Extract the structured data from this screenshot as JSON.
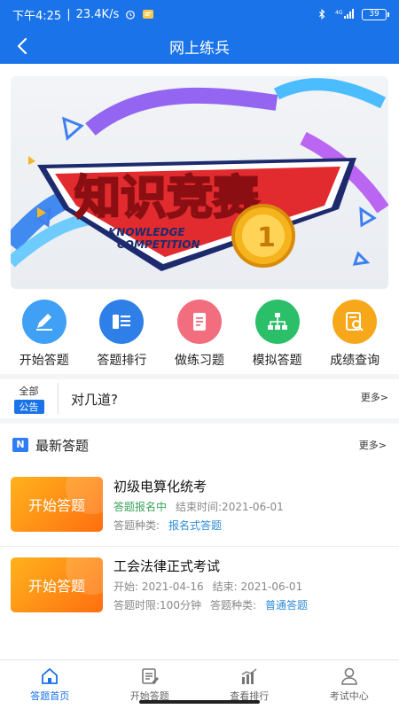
{
  "status": {
    "time": "下午4:25",
    "speed": "23.4K/s",
    "battery": "39",
    "signal_label": "4G"
  },
  "nav": {
    "title": "网上练兵",
    "back_icon": "back-arrow-icon"
  },
  "banner": {
    "title": "知识竞赛",
    "subtitle_line1": "KNOWLEDGE",
    "subtitle_line2": "COMPETITION",
    "medal_number": "1"
  },
  "grid": [
    {
      "label": "开始答题",
      "icon": "pencil-icon",
      "color": "#3fa0f5"
    },
    {
      "label": "答题排行",
      "icon": "ranking-list-icon",
      "color": "#2f7fe8"
    },
    {
      "label": "做练习题",
      "icon": "document-icon",
      "color": "#f26d7d"
    },
    {
      "label": "模拟答题",
      "icon": "org-chart-icon",
      "color": "#2bbf6a"
    },
    {
      "label": "成绩查询",
      "icon": "search-document-icon",
      "color": "#f7a81a"
    }
  ],
  "notice": {
    "all": "全部",
    "badge": "公告",
    "text": "对几道?",
    "more": "更多>"
  },
  "section": {
    "icon_text": "N",
    "title": "最新答题",
    "more": "更多>"
  },
  "exams": [
    {
      "thumb": "开始答题",
      "title": "初级电算化统考",
      "line1_a": "答题报名中",
      "line1_b": "结束时间:2021-06-01",
      "line2_label": "答题种类:",
      "line2_value": "报名式答题"
    },
    {
      "thumb": "开始答题",
      "title": "工会法律正式考试",
      "line1_a": "开始:  2021-04-16",
      "line1_b": "结束:  2021-06-01",
      "line2_label": "答题时限:100分钟",
      "line2_label2": "答题种类:",
      "line2_value": "普通答题"
    }
  ],
  "tabs": [
    {
      "label": "答题首页",
      "icon": "home-icon",
      "active": true
    },
    {
      "label": "开始答题",
      "icon": "edit-icon",
      "active": false
    },
    {
      "label": "查看排行",
      "icon": "bar-chart-icon",
      "active": false
    },
    {
      "label": "考试中心",
      "icon": "user-icon",
      "active": false
    }
  ],
  "colors": {
    "primary": "#1a73e8",
    "accent_green": "#3aa35b",
    "accent_blue": "#2e8cd9"
  }
}
